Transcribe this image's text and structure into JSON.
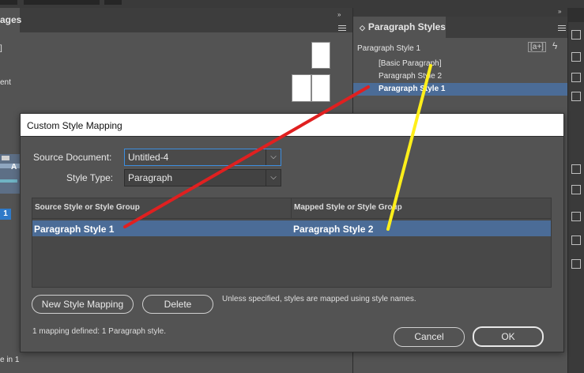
{
  "pages_panel": {
    "tab_label": "ages",
    "fragments": [
      "]",
      "ent",
      "1",
      "e in 1"
    ]
  },
  "paragraph_styles": {
    "tab_label": "Paragraph Styles",
    "current_style": "Paragraph Style 1",
    "new_group_label": "[a+]",
    "items": [
      {
        "label": "[Basic Paragraph]",
        "selected": false
      },
      {
        "label": "Paragraph Style 2",
        "selected": false
      },
      {
        "label": "Paragraph Style 1",
        "selected": true
      }
    ]
  },
  "dialog": {
    "title": "Custom Style Mapping",
    "source_document_label": "Source Document:",
    "source_document_value": "Untitled-4",
    "style_type_label": "Style Type:",
    "style_type_value": "Paragraph",
    "table": {
      "col_source": "Source Style or Style Group",
      "col_mapped": "Mapped Style or Style Group",
      "rows": [
        {
          "source": "Paragraph Style 1",
          "mapped": "Paragraph Style 2"
        }
      ]
    },
    "new_mapping_button": "New Style Mapping",
    "delete_button": "Delete",
    "note": "Unless specified, styles are mapped using style names.",
    "status": "1 mapping defined:  1 Paragraph style.",
    "cancel_button": "Cancel",
    "ok_button": "OK"
  },
  "annotations": {
    "red_line_color": "#e02020",
    "yellow_line_color": "#ffef1a"
  }
}
